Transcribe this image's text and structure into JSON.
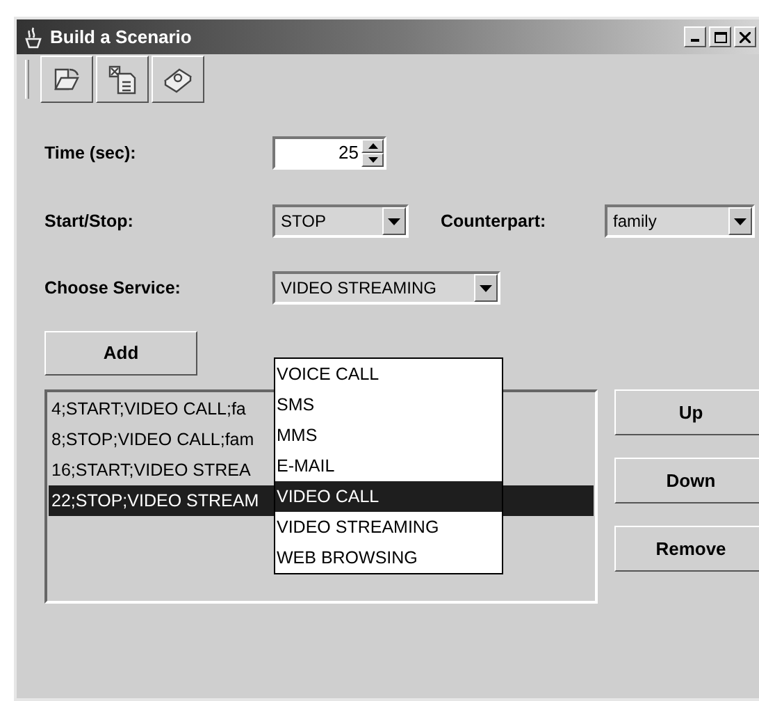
{
  "window": {
    "title": "Build a Scenario"
  },
  "form": {
    "time_label": "Time (sec):",
    "time_value": "25",
    "start_stop_label": "Start/Stop:",
    "start_stop_value": "STOP",
    "counterpart_label": "Counterpart:",
    "counterpart_value": "family",
    "service_label": "Choose Service:",
    "service_value": "VIDEO STREAMING"
  },
  "add_button": "Add",
  "events": [
    {
      "text": "4;START;VIDEO CALL;fa",
      "selected": false
    },
    {
      "text": "8;STOP;VIDEO CALL;fam",
      "selected": false
    },
    {
      "text": "16;START;VIDEO STREA",
      "selected": false
    },
    {
      "text": "22;STOP;VIDEO STREAM",
      "selected": true
    }
  ],
  "service_options": [
    {
      "label": "VOICE CALL",
      "selected": false
    },
    {
      "label": "SMS",
      "selected": false
    },
    {
      "label": "MMS",
      "selected": false
    },
    {
      "label": "E-MAIL",
      "selected": false
    },
    {
      "label": "VIDEO CALL",
      "selected": true
    },
    {
      "label": "VIDEO STREAMING",
      "selected": false
    },
    {
      "label": "WEB BROWSING",
      "selected": false
    }
  ],
  "side_buttons": [
    "Up",
    "Down",
    "Remove"
  ]
}
